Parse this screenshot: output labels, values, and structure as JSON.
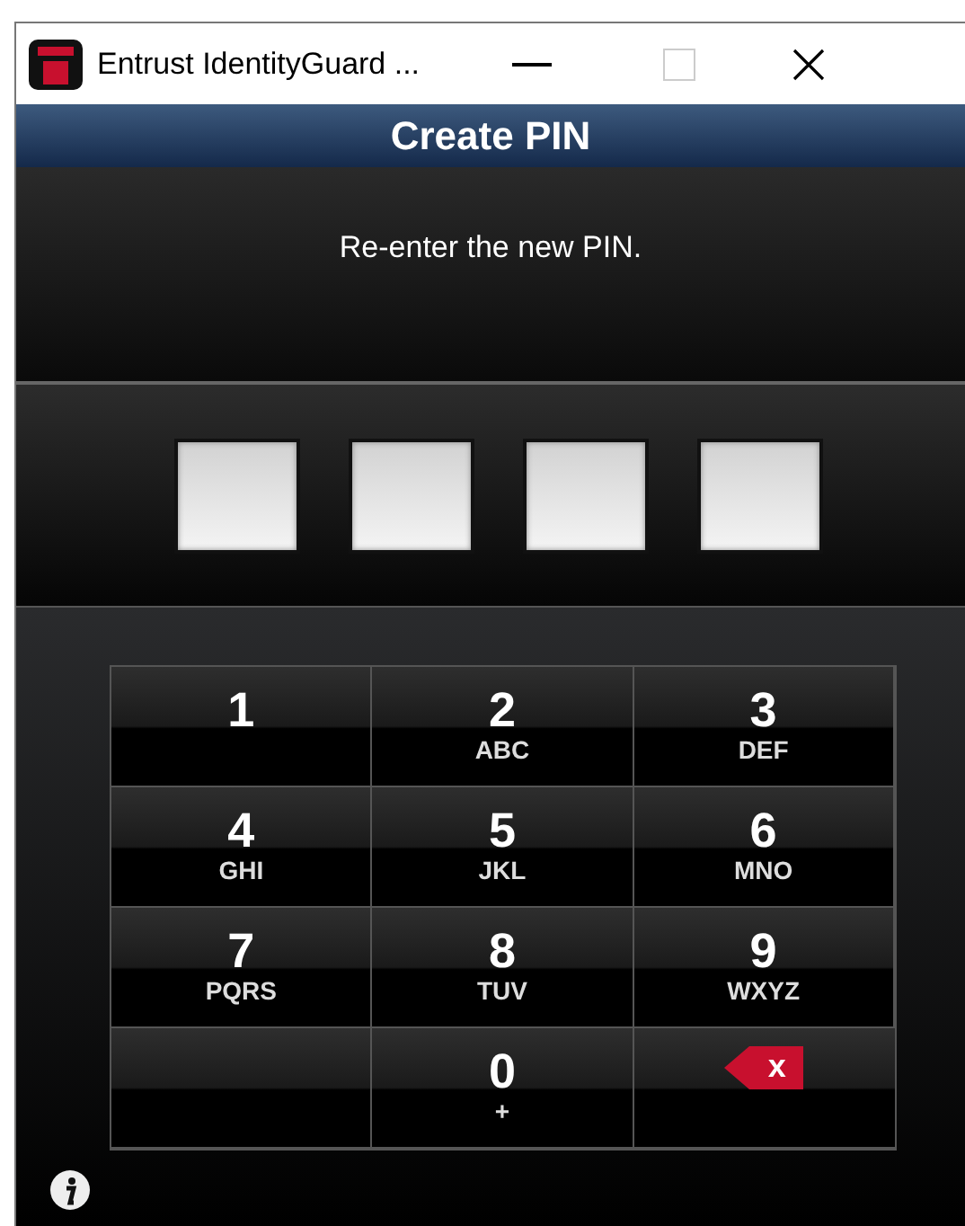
{
  "window": {
    "title": "Entrust IdentityGuard ..."
  },
  "header": {
    "title": "Create PIN"
  },
  "message": "Re-enter the new PIN.",
  "pin_boxes": [
    {
      "filled": false
    },
    {
      "filled": false
    },
    {
      "filled": false
    },
    {
      "filled": false
    }
  ],
  "keypad": [
    {
      "kind": "digit",
      "digit": "1"
    },
    {
      "kind": "digit",
      "digit": "2",
      "letters": "ABC"
    },
    {
      "kind": "digit",
      "digit": "3",
      "letters": "DEF"
    },
    {
      "kind": "digit",
      "digit": "4",
      "letters": "GHI"
    },
    {
      "kind": "digit",
      "digit": "5",
      "letters": "JKL"
    },
    {
      "kind": "digit",
      "digit": "6",
      "letters": "MNO"
    },
    {
      "kind": "digit",
      "digit": "7",
      "letters": "PQRS"
    },
    {
      "kind": "digit",
      "digit": "8",
      "letters": "TUV"
    },
    {
      "kind": "digit",
      "digit": "9",
      "letters": "WXYZ"
    },
    {
      "kind": "blank"
    },
    {
      "kind": "digit",
      "digit": "0",
      "letters": "+"
    },
    {
      "kind": "delete",
      "label": "x"
    }
  ]
}
